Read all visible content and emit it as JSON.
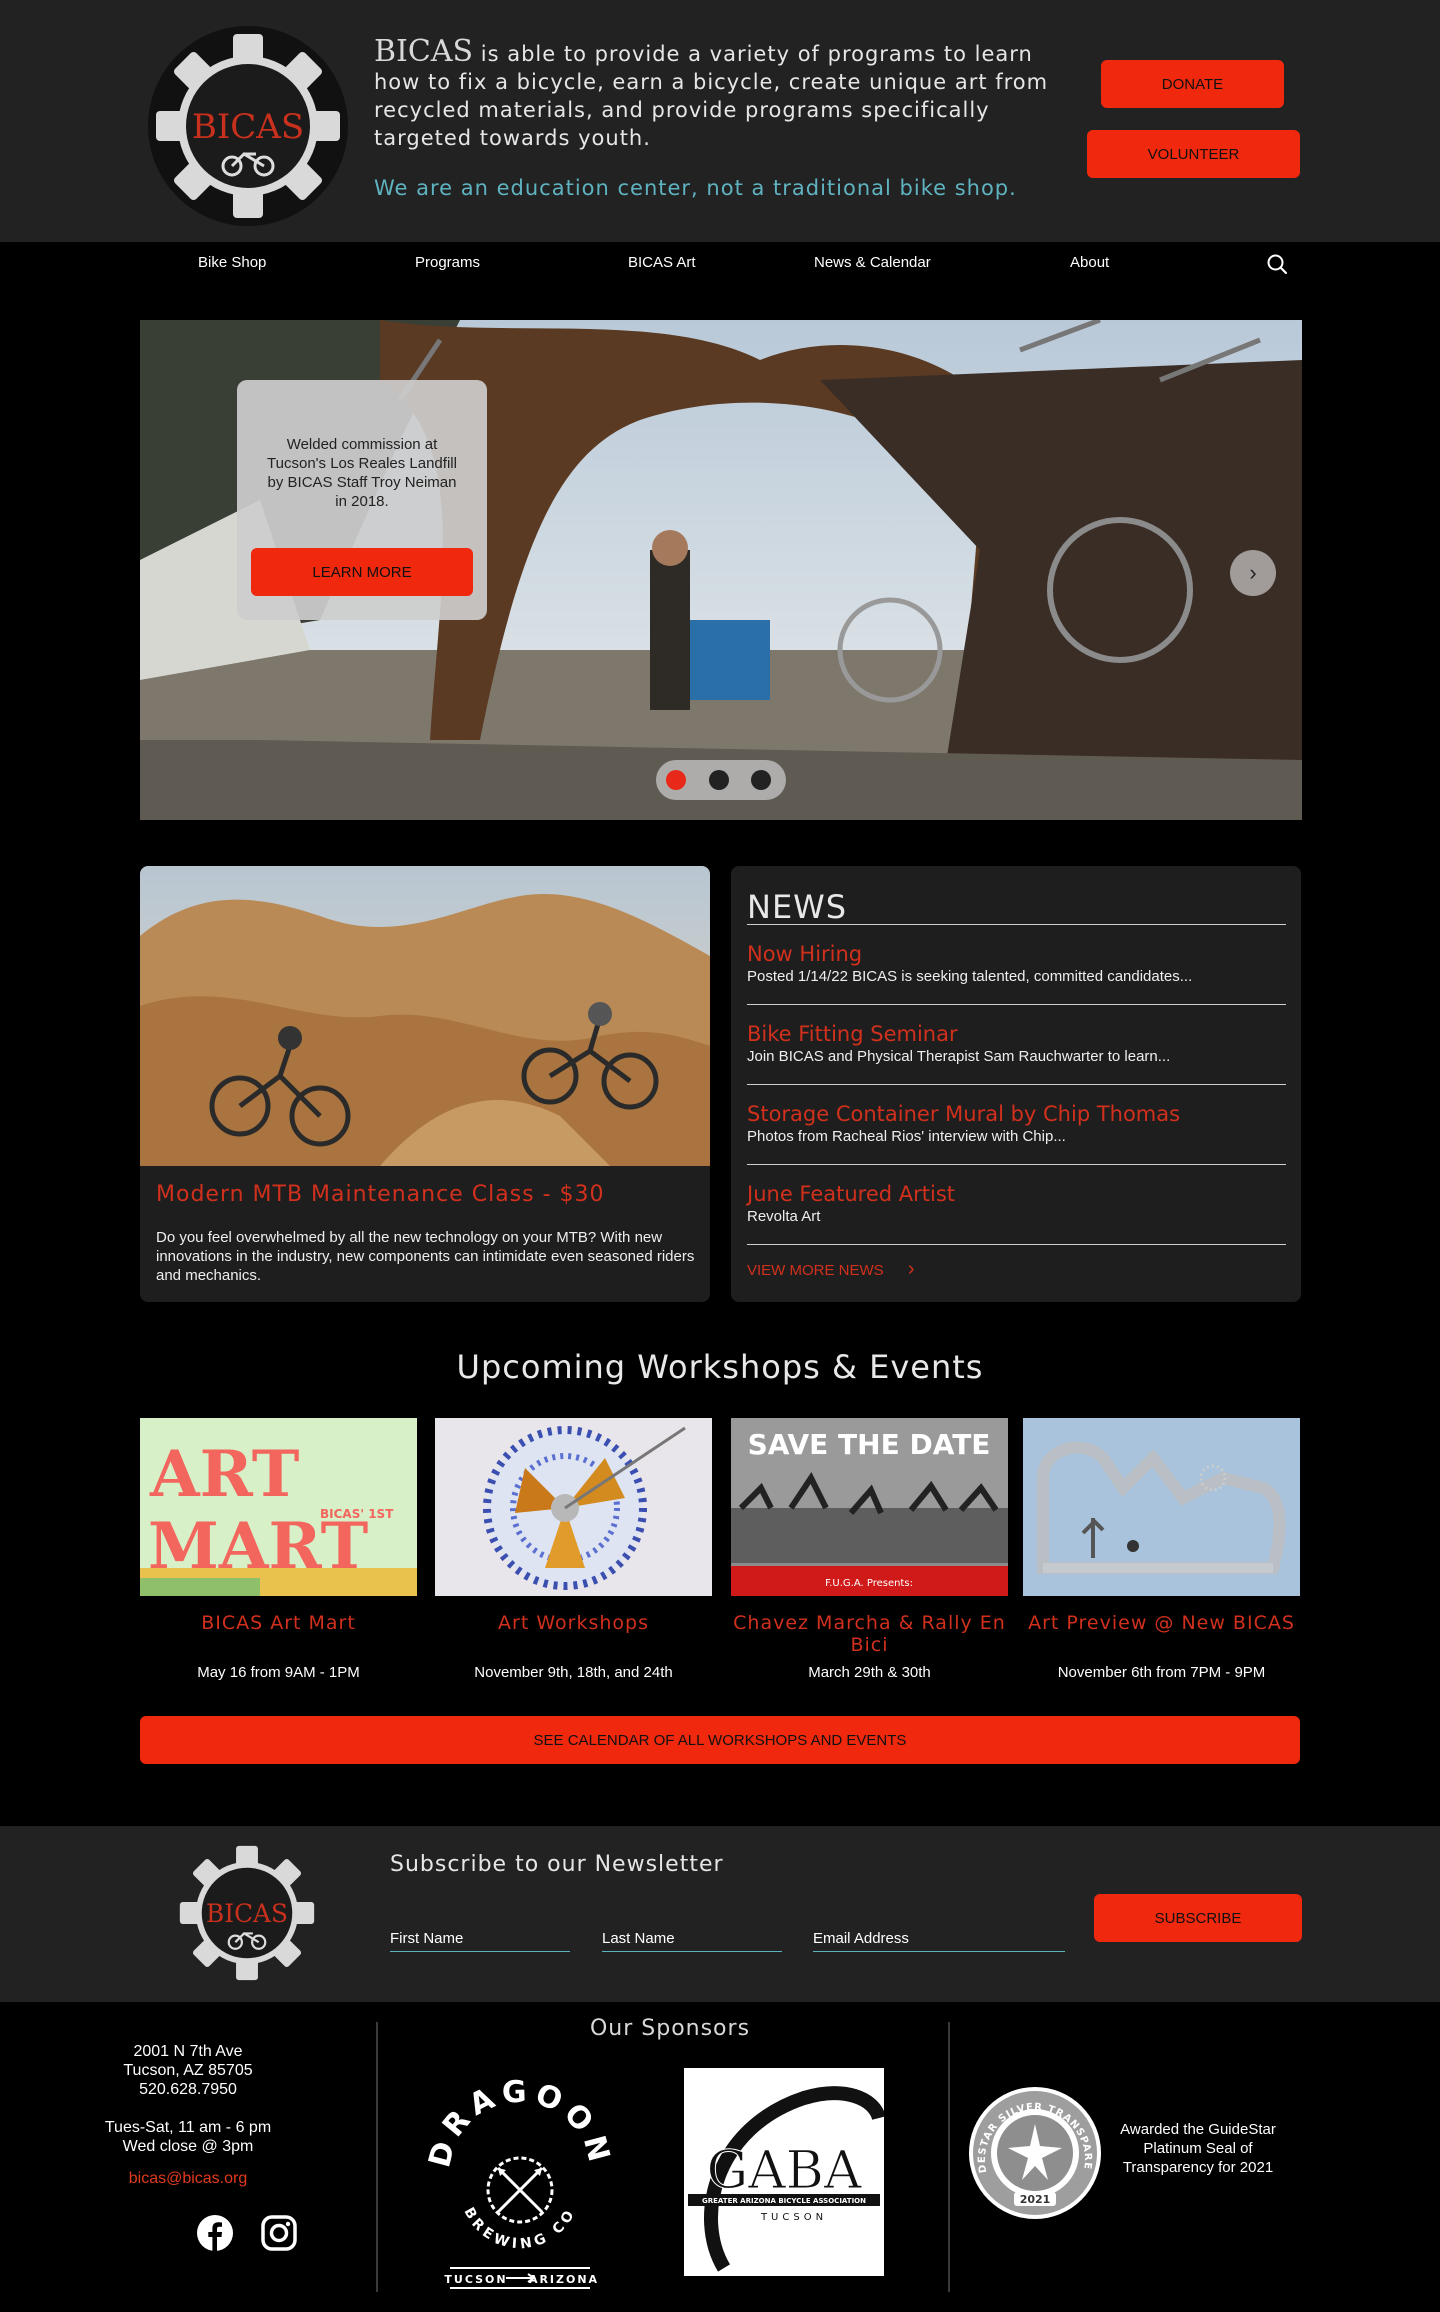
{
  "header": {
    "brand": "BICAS",
    "intro": " is able to provide a variety of programs to learn how to fix a bicycle, earn a bicycle, create unique art from recycled materials, and provide programs specifically targeted towards youth.",
    "tagline": "We are an education center, not a traditional bike shop.",
    "donate_label": "DONATE",
    "volunteer_label": "VOLUNTEER"
  },
  "nav": {
    "items": [
      "Bike Shop",
      "Programs",
      "BICAS Art",
      "News & Calendar",
      "About"
    ]
  },
  "hero": {
    "caption": "Welded commission at Tucson's Los Reales Landfill by BICAS Staff Troy Neiman in 2018.",
    "button_label": "LEARN MORE",
    "next_glyph": "›",
    "slide_count": 3,
    "active_slide": 1
  },
  "feature": {
    "title": "Modern MTB Maintenance Class - $30",
    "description": "Do you feel overwhelmed by all the new technology on your MTB? With new innovations in the industry, new components can intimidate even seasoned riders and mechanics."
  },
  "news": {
    "heading": "NEWS",
    "items": [
      {
        "title": "Now Hiring",
        "snippet": "Posted 1/14/22 BICAS is seeking talented, committed candidates..."
      },
      {
        "title": "Bike Fitting Seminar",
        "snippet": "Join BICAS and Physical Therapist Sam Rauchwarter to learn..."
      },
      {
        "title": "Storage Container Mural by Chip Thomas",
        "snippet": "Photos from Racheal Rios' interview with Chip..."
      },
      {
        "title": "June Featured Artist",
        "snippet": "Revolta Art"
      }
    ],
    "view_more": "VIEW MORE NEWS",
    "view_more_glyph": "›"
  },
  "events": {
    "heading": "Upcoming Workshops & Events",
    "items": [
      {
        "title": "BICAS Art Mart",
        "date": "May 16 from 9AM - 1PM",
        "img_text1": "ART",
        "img_text2": "MART",
        "img_tag": "BICAS' 1ST"
      },
      {
        "title": "Art Workshops",
        "date": "November 9th,  18th, and 24th"
      },
      {
        "title": "Chavez Marcha & Rally En Bici",
        "date": "March 29th & 30th",
        "img_text1": "SAVE THE DATE",
        "img_tag": "F.U.G.A. Presents:"
      },
      {
        "title": "Art Preview @ New BICAS",
        "date": "November 6th from 7PM - 9PM"
      }
    ],
    "calendar_label": "SEE CALENDAR OF ALL WORKSHOPS AND EVENTS"
  },
  "newsletter": {
    "heading": "Subscribe to our Newsletter",
    "first_name": "First Name",
    "last_name": "Last Name",
    "email": "Email Address",
    "subscribe_label": "SUBSCRIBE"
  },
  "footer": {
    "address1": "2001 N 7th Ave",
    "address2": "Tucson, AZ 85705",
    "phone": "520.628.7950",
    "hours1": "Tues-Sat, 11 am - 6 pm",
    "hours2": "Wed close @ 3pm",
    "email": "bicas@bicas.org",
    "sponsors_heading": "Our Sponsors",
    "dragoon": {
      "name": "DRAGOON",
      "sub": "BREWING CO",
      "city": "TUCSON",
      "state": "ARIZONA"
    },
    "gaba": {
      "name": "GABA",
      "sub": "GREATER ARIZONA BICYCLE ASSOCIATION",
      "city": "TUCSON"
    },
    "seal": {
      "ring": "GUIDESTAR SILVER TRANSPARENCY",
      "year": "2021"
    },
    "seal_text": "Awarded the GuideStar Platinum Seal of Transparency for 2021"
  },
  "colors": {
    "accent": "#f0280e",
    "title_red": "#d1301d",
    "teal": "#5fb3c0",
    "header_bg": "#222222"
  }
}
